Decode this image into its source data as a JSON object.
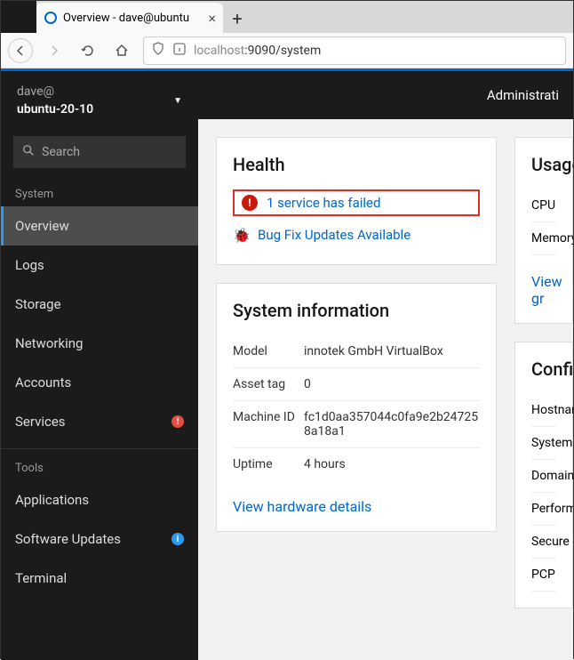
{
  "browser": {
    "tab_title": "Overview - dave@ubuntu",
    "url_display": "localhost:9090/system",
    "url_host_part": "localhost",
    "url_port_path": ":9090/system"
  },
  "topbar": {
    "right_text": "Administrati"
  },
  "sidebar": {
    "user": "dave@",
    "host": "ubuntu-20-10",
    "search_placeholder": "Search",
    "section_system": "System",
    "section_tools": "Tools",
    "items_system": [
      {
        "label": "Overview",
        "active": true
      },
      {
        "label": "Logs"
      },
      {
        "label": "Storage"
      },
      {
        "label": "Networking"
      },
      {
        "label": "Accounts"
      },
      {
        "label": "Services",
        "badge": "red"
      }
    ],
    "items_tools": [
      {
        "label": "Applications"
      },
      {
        "label": "Software Updates",
        "badge": "blue"
      },
      {
        "label": "Terminal"
      }
    ]
  },
  "health": {
    "title": "Health",
    "failed_text": "1 service has failed",
    "updates_text": "Bug Fix Updates Available"
  },
  "sysinfo": {
    "title": "System information",
    "rows": [
      {
        "label": "Model",
        "value": "innotek GmbH VirtualBox"
      },
      {
        "label": "Asset tag",
        "value": "0"
      },
      {
        "label": "Machine ID",
        "value": "fc1d0aa357044c0fa9e2b247258a18a1"
      },
      {
        "label": "Uptime",
        "value": "4 hours"
      }
    ],
    "link": "View hardware details"
  },
  "usage": {
    "title": "Usage",
    "rows": [
      "CPU",
      "Memory"
    ],
    "link": "View gr"
  },
  "config": {
    "title": "Confi",
    "rows": [
      "Hostnam",
      "System",
      "Domain",
      "Perform profile",
      "Secure S",
      "PCP"
    ]
  }
}
